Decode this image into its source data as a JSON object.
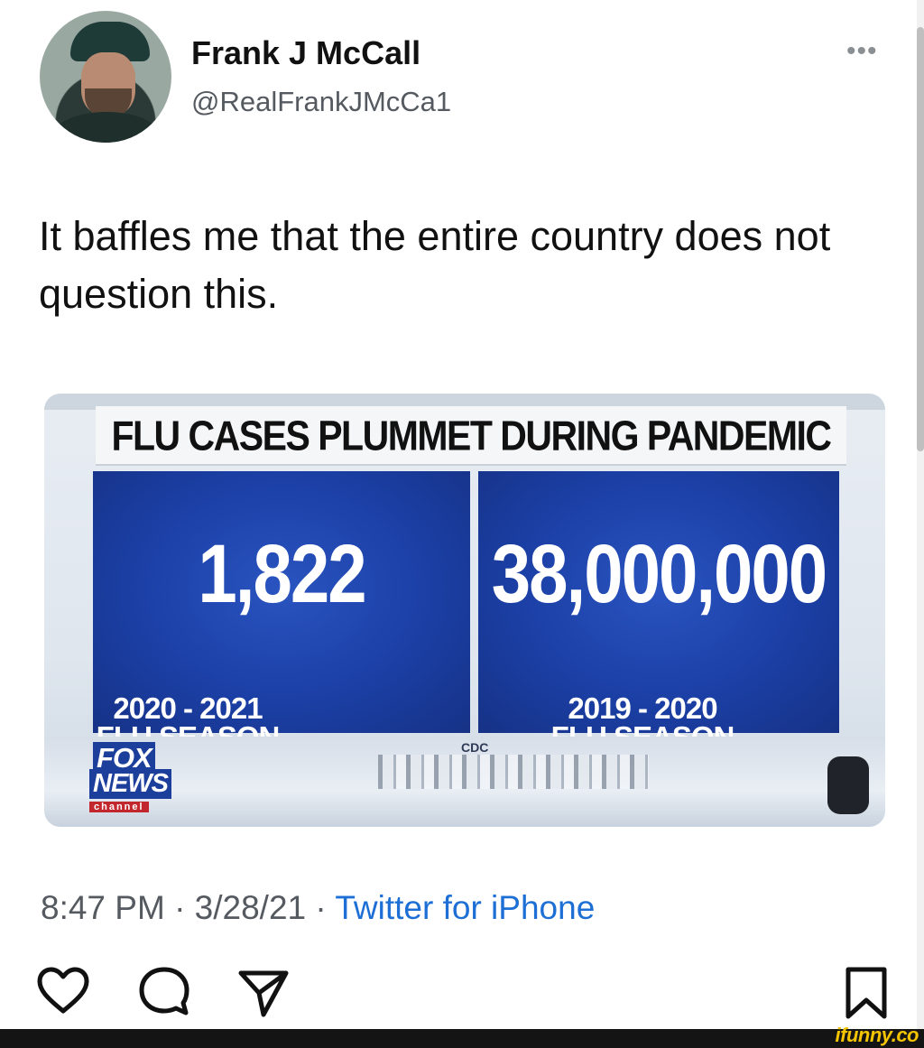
{
  "tweet": {
    "author_name": "Frank J McCall",
    "author_handle": "@RealFrankJMcCa1",
    "more_icon": "more-options-icon",
    "more_label": "•••",
    "text": "It baffles me that the entire country does not question this.",
    "timestamp": "8:47 PM · 3/28/21 ·",
    "source": "Twitter for iPhone"
  },
  "media": {
    "headline": "FLU CASES PLUMMET DURING PANDEMIC",
    "left_number": "1,822",
    "left_season_line1": "2020 - 2021",
    "left_season_line2": "FLU SEASON",
    "right_number": "38,000,000",
    "right_season_line1": "2019 - 2020",
    "right_season_line2": "FLU SEASON",
    "cdc_label": "CDC",
    "logo_fox": "FOX",
    "logo_news": "NEWS",
    "logo_channel": "channel"
  },
  "actions": {
    "icons": [
      "heart-icon",
      "comment-icon",
      "share-icon",
      "bookmark-icon"
    ]
  },
  "watermark": {
    "text": "ifunny.co",
    "color": "#f5c400"
  },
  "colors": {
    "panel_blue": "#1b3fa5",
    "link_blue": "#1d6fd6"
  }
}
